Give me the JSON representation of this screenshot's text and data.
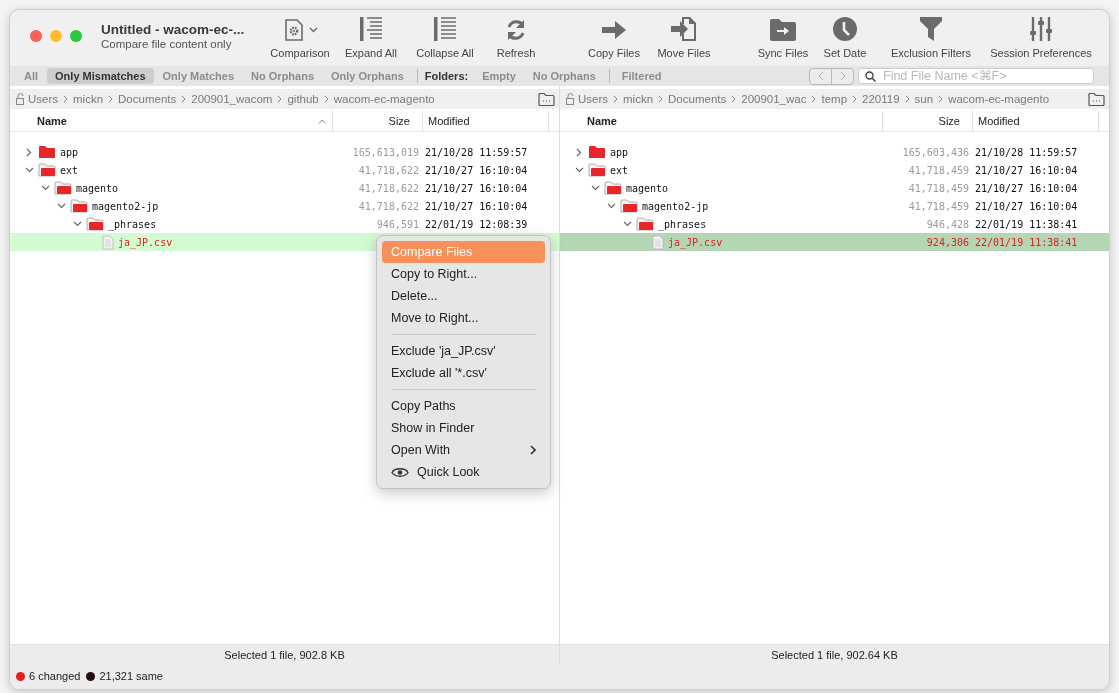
{
  "window": {
    "title": "Untitled - wacom-ec-...",
    "subtitle": "Compare file content only"
  },
  "toolbar": [
    {
      "label": "Comparison",
      "kind": "comparison",
      "dropdown": true
    },
    {
      "label": "Expand All",
      "kind": "expand",
      "dropdown": false
    },
    {
      "label": "Collapse All",
      "kind": "collapse",
      "dropdown": false
    },
    {
      "label": "Refresh",
      "kind": "refresh",
      "dropdown": false
    },
    {
      "label": "Copy Files",
      "kind": "copy",
      "dropdown": false
    },
    {
      "label": "Move Files",
      "kind": "move",
      "dropdown": false
    },
    {
      "label": "Sync Files",
      "kind": "sync",
      "dropdown": false
    },
    {
      "label": "Set Date",
      "kind": "date",
      "dropdown": false
    },
    {
      "label": "Exclusion Filters",
      "kind": "filter",
      "dropdown": false
    },
    {
      "label": "Session Preferences",
      "kind": "prefs",
      "dropdown": false
    }
  ],
  "filters": [
    {
      "label": "All",
      "selected": false
    },
    {
      "label": "Only Mismatches",
      "selected": true
    },
    {
      "label": "Only Matches",
      "selected": false
    },
    {
      "label": "No Orphans",
      "selected": false
    },
    {
      "label": "Only Orphans",
      "selected": false
    }
  ],
  "folders_label": "Folders:",
  "folder_filters": [
    {
      "label": "Empty",
      "selected": false
    },
    {
      "label": "No Orphans",
      "selected": false
    },
    {
      "label": "Filtered",
      "selected": false
    }
  ],
  "search": {
    "placeholder": "Find File Name <⌘F>"
  },
  "panes": [
    {
      "focused": false,
      "path": [
        "Users",
        "mickn",
        "Documents",
        "200901_wacom",
        "github",
        "wacom-ec-magento"
      ],
      "columns": [
        {
          "label": "Name",
          "sorted": true
        },
        {
          "label": "Size",
          "sorted": false
        },
        {
          "label": "Modified",
          "sorted": false
        }
      ],
      "rows": [
        {
          "name": "app",
          "kind": "folder",
          "expanded": false,
          "size": "165,613,019",
          "modified": "21/10/28 11:59:57",
          "changed": false,
          "selected": false
        },
        {
          "name": "ext",
          "kind": "folder",
          "expanded": true,
          "size": "41,718,622",
          "modified": "21/10/27 16:10:04",
          "changed": false,
          "selected": false,
          "children": [
            {
              "name": "magento",
              "kind": "folder",
              "expanded": true,
              "size": "41,718,622",
              "modified": "21/10/27 16:10:04",
              "changed": false,
              "selected": false,
              "children": [
                {
                  "name": "magento2-jp",
                  "kind": "folder",
                  "expanded": true,
                  "size": "41,718,622",
                  "modified": "21/10/27 16:10:04",
                  "changed": false,
                  "selected": false,
                  "children": [
                    {
                      "name": "_phrases",
                      "kind": "folder",
                      "expanded": true,
                      "size": "946,591",
                      "modified": "22/01/19 12:08:39",
                      "changed": false,
                      "selected": false,
                      "children": [
                        {
                          "name": "ja_JP.csv",
                          "kind": "file",
                          "changed": true,
                          "selected": true
                        }
                      ]
                    }
                  ]
                }
              ]
            }
          ]
        }
      ],
      "status": "Selected 1 file, 902.8 KB"
    },
    {
      "focused": true,
      "path": [
        "Users",
        "mickn",
        "Documents",
        "200901_wac",
        "temp",
        "220119",
        "sun",
        "wacom-ec-magento"
      ],
      "columns": [
        {
          "label": "Name",
          "sorted": false
        },
        {
          "label": "Size",
          "sorted": false
        },
        {
          "label": "Modified",
          "sorted": false
        }
      ],
      "rows": [
        {
          "name": "app",
          "kind": "folder",
          "expanded": false,
          "size": "165,603,436",
          "modified": "21/10/28 11:59:57",
          "changed": false,
          "selected": false
        },
        {
          "name": "ext",
          "kind": "folder",
          "expanded": true,
          "size": "41,718,459",
          "modified": "21/10/27 16:10:04",
          "changed": false,
          "selected": false,
          "children": [
            {
              "name": "magento",
              "kind": "folder",
              "expanded": true,
              "size": "41,718,459",
              "modified": "21/10/27 16:10:04",
              "changed": false,
              "selected": false,
              "children": [
                {
                  "name": "magento2-jp",
                  "kind": "folder",
                  "expanded": true,
                  "size": "41,718,459",
                  "modified": "21/10/27 16:10:04",
                  "changed": false,
                  "selected": false,
                  "children": [
                    {
                      "name": "_phrases",
                      "kind": "folder",
                      "expanded": true,
                      "size": "946,428",
                      "modified": "22/01/19 11:38:41",
                      "changed": false,
                      "selected": false,
                      "children": [
                        {
                          "name": "ja_JP.csv",
                          "kind": "file",
                          "size": "924,306",
                          "modified": "22/01/19 11:38:41",
                          "changed": true,
                          "selected": true
                        }
                      ]
                    }
                  ]
                }
              ]
            }
          ]
        }
      ],
      "status": "Selected 1 file, 902.64 KB"
    }
  ],
  "context_menu": [
    {
      "label": "Compare Files",
      "kind": "item",
      "selected": true
    },
    {
      "label": "Copy to Right...",
      "kind": "item",
      "selected": false
    },
    {
      "label": "Delete...",
      "kind": "item",
      "selected": false
    },
    {
      "label": "Move to Right...",
      "kind": "item",
      "selected": false
    },
    {
      "kind": "separator"
    },
    {
      "label": "Exclude 'ja_JP.csv'",
      "kind": "item",
      "selected": false
    },
    {
      "label": "Exclude all '*.csv'",
      "kind": "item",
      "selected": false
    },
    {
      "kind": "separator"
    },
    {
      "label": "Copy Paths",
      "kind": "item",
      "selected": false
    },
    {
      "label": "Show in Finder",
      "kind": "item",
      "selected": false
    },
    {
      "label": "Open With",
      "kind": "submenu",
      "selected": false
    },
    {
      "label": "Quick Look",
      "kind": "preview",
      "selected": false
    }
  ],
  "legend": [
    {
      "label": "6 changed",
      "color": "#e0201c"
    },
    {
      "label": "21,321 same",
      "color": "#2b0a0a"
    }
  ]
}
